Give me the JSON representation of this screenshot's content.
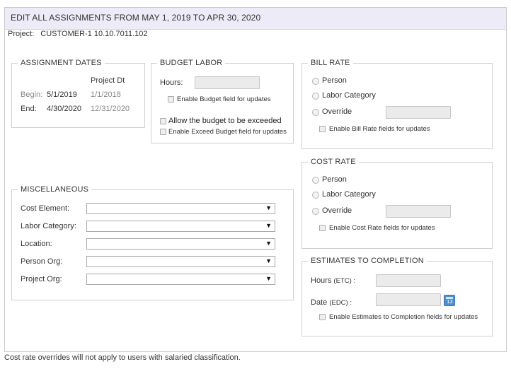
{
  "header": {
    "title": "EDIT ALL ASSIGNMENTS FROM MAY 1, 2019 TO APR 30, 2020"
  },
  "project": {
    "label": "Project:",
    "value": "CUSTOMER-1 10.10.7011.102"
  },
  "assignment_dates": {
    "legend": "ASSIGNMENT DATES",
    "project_dt_header": "Project Dt",
    "begin_label": "Begin:",
    "begin_value": "5/1/2019",
    "begin_project": "1/1/2018",
    "end_label": "End:",
    "end_value": "4/30/2020",
    "end_project": "12/31/2020"
  },
  "budget_labor": {
    "legend": "BUDGET LABOR",
    "hours_label": "Hours:",
    "hours_value": "",
    "enable_budget_label": "Enable Budget field for updates",
    "allow_exceed_label": "Allow the budget to be exceeded",
    "enable_exceed_label": "Enable Exceed Budget field for updates"
  },
  "bill_rate": {
    "legend": "BILL RATE",
    "person_label": "Person",
    "labor_category_label": "Labor Category",
    "override_label": "Override",
    "override_value": "",
    "enable_label": "Enable Bill Rate fields for updates"
  },
  "cost_rate": {
    "legend": "COST RATE",
    "person_label": "Person",
    "labor_category_label": "Labor Category",
    "override_label": "Override",
    "override_value": "",
    "enable_label": "Enable Cost Rate fields for updates"
  },
  "misc": {
    "legend": "MISCELLANEOUS",
    "fields": [
      {
        "label": "Cost Element:",
        "value": ""
      },
      {
        "label": "Labor Category:",
        "value": ""
      },
      {
        "label": "Location:",
        "value": ""
      },
      {
        "label": "Person Org:",
        "value": ""
      },
      {
        "label": "Project Org:",
        "value": ""
      }
    ]
  },
  "etc": {
    "legend": "ESTIMATES TO COMPLETION",
    "hours_label": "Hours",
    "hours_suffix": "(ETC) :",
    "hours_value": "",
    "date_label": "Date",
    "date_suffix": "(EDC) :",
    "date_value": "",
    "calendar_text": "12",
    "enable_label": "Enable Estimates to Completion fields for updates"
  },
  "footer": {
    "note": "Cost rate overrides will not apply to users with salaried classification."
  },
  "colors": {
    "header_bg": "#ecebf7",
    "border": "#cfcfcf",
    "calendar_icon": "#4a8fd8"
  },
  "icons": {
    "dropdown": "chevron-down-icon",
    "calendar": "calendar-icon"
  }
}
